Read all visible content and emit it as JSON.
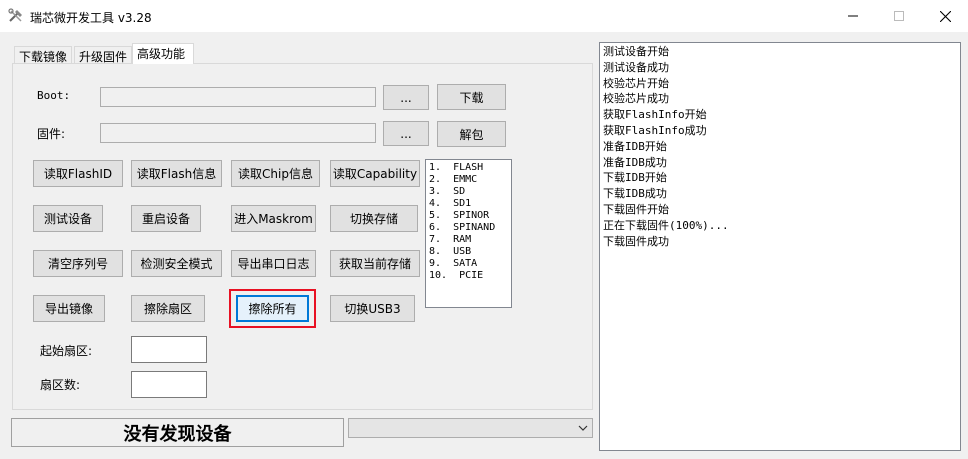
{
  "window": {
    "title": "瑞芯微开发工具 v3.28",
    "icon": "tools-icon"
  },
  "tabs": [
    {
      "label": "下载镜像",
      "active": false
    },
    {
      "label": "升级固件",
      "active": false
    },
    {
      "label": "高级功能",
      "active": true
    }
  ],
  "boot": {
    "label": "Boot:",
    "value": "",
    "browse_label": "...",
    "action_label": "下载"
  },
  "firmware": {
    "label": "固件:",
    "value": "",
    "browse_label": "...",
    "action_label": "解包"
  },
  "buttons": {
    "read_flash_id": "读取FlashID",
    "read_flash_info": "读取Flash信息",
    "read_chip_info": "读取Chip信息",
    "read_capability": "读取Capability",
    "test_device": "测试设备",
    "restart_device": "重启设备",
    "enter_maskrom": "进入Maskrom",
    "switch_storage": "切换存储",
    "clear_serial": "清空序列号",
    "check_secure_mode": "检测安全模式",
    "export_uart_log": "导出串口日志",
    "get_current_storage": "获取当前存储",
    "export_image": "导出镜像",
    "erase_sector": "擦除扇区",
    "erase_all": "擦除所有",
    "switch_usb3": "切换USB3"
  },
  "storage_list": [
    "1.  FLASH",
    "2.  EMMC",
    "3.  SD",
    "4.  SD1",
    "5.  SPINOR",
    "6.  SPINAND",
    "7.  RAM",
    "8.  USB",
    "9.  SATA",
    "10.  PCIE"
  ],
  "sector": {
    "start_label": "起始扇区:",
    "start_value": "",
    "count_label": "扇区数:",
    "count_value": ""
  },
  "status": {
    "text": "没有发现设备"
  },
  "device_combo": {
    "value": ""
  },
  "log_lines": [
    "测试设备开始",
    "测试设备成功",
    "校验芯片开始",
    "校验芯片成功",
    "获取FlashInfo开始",
    "获取FlashInfo成功",
    "准备IDB开始",
    "准备IDB成功",
    "下载IDB开始",
    "下载IDB成功",
    "下载固件开始",
    "正在下载固件(100%)...",
    "下载固件成功"
  ],
  "colors": {
    "highlight_box": "#e81123",
    "focus_border": "#0078d7"
  }
}
